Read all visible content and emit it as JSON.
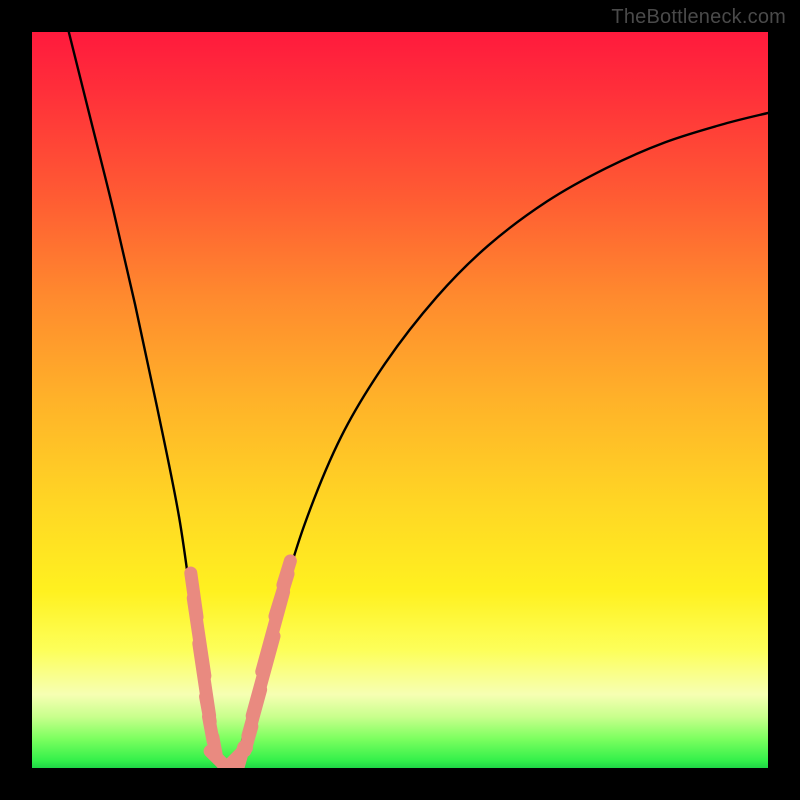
{
  "watermark": "TheBottleneck.com",
  "chart_data": {
    "type": "line",
    "title": "",
    "xlabel": "",
    "ylabel": "",
    "xlim": [
      0,
      100
    ],
    "ylim": [
      0,
      100
    ],
    "series": [
      {
        "name": "bottleneck-curve",
        "x": [
          5,
          8,
          11,
          14,
          17,
          20,
          22,
          23.5,
          25,
          26.5,
          28,
          30,
          33,
          37,
          42,
          48,
          55,
          62,
          70,
          78,
          86,
          94,
          100
        ],
        "y": [
          100,
          88,
          76,
          63,
          49,
          34,
          20,
          10,
          2,
          0.5,
          2,
          9,
          20,
          33,
          45,
          55,
          64,
          71,
          77,
          81.5,
          85,
          87.5,
          89
        ]
      }
    ],
    "markers": [
      {
        "name": "left-cluster",
        "shape": "rounded-bead",
        "color": "#e98a80",
        "points": [
          {
            "x": 22.0,
            "y": 23.5,
            "len": 3.0
          },
          {
            "x": 22.7,
            "y": 17.8,
            "len": 4.8
          },
          {
            "x": 23.4,
            "y": 12.0,
            "len": 4.5
          },
          {
            "x": 23.9,
            "y": 8.0,
            "len": 2.0
          },
          {
            "x": 24.3,
            "y": 5.3,
            "len": 2.0
          },
          {
            "x": 24.8,
            "y": 3.0,
            "len": 1.6
          }
        ]
      },
      {
        "name": "valley-cluster",
        "shape": "rounded-bead",
        "color": "#e98a80",
        "points": [
          {
            "x": 25.6,
            "y": 0.9,
            "len": 2.2
          },
          {
            "x": 27.0,
            "y": 0.6,
            "len": 3.0
          },
          {
            "x": 28.3,
            "y": 1.2,
            "len": 2.0
          }
        ]
      },
      {
        "name": "right-cluster",
        "shape": "rounded-bead",
        "color": "#e98a80",
        "points": [
          {
            "x": 29.4,
            "y": 4.0,
            "len": 2.0
          },
          {
            "x": 30.2,
            "y": 7.5,
            "len": 3.2
          },
          {
            "x": 31.4,
            "y": 12.5,
            "len": 5.0
          },
          {
            "x": 32.7,
            "y": 18.5,
            "len": 5.0
          },
          {
            "x": 33.9,
            "y": 23.5,
            "len": 3.0
          },
          {
            "x": 34.6,
            "y": 26.5,
            "len": 2.0
          }
        ]
      }
    ],
    "gradient_stops": [
      {
        "pos": 0.0,
        "color": "#ff1a3d"
      },
      {
        "pos": 0.36,
        "color": "#ff8a2e"
      },
      {
        "pos": 0.76,
        "color": "#fff120"
      },
      {
        "pos": 0.93,
        "color": "#c9ff8d"
      },
      {
        "pos": 1.0,
        "color": "#1fd646"
      }
    ]
  }
}
